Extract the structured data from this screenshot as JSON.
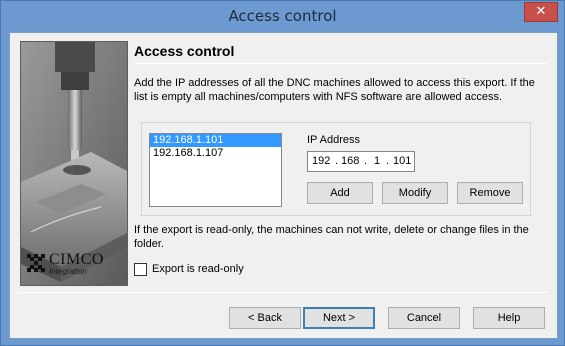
{
  "window": {
    "title": "Access control",
    "close_label": "✕"
  },
  "wizard": {
    "heading": "Access control",
    "description": "Add the IP addresses of all the DNC machines allowed to access this export. If the list is empty all machines/computers with NFS software are allowed access."
  },
  "ip_list": {
    "items": [
      "192.168.1.101",
      "192.168.1.107"
    ],
    "selected_index": 0
  },
  "ip_address": {
    "label": "IP Address",
    "octets": [
      "192",
      "168",
      "1",
      "101"
    ],
    "separator": "."
  },
  "buttons": {
    "add": "Add",
    "modify": "Modify",
    "remove": "Remove"
  },
  "readonly": {
    "note": "If the export is read-only, the machines can not write, delete or change files in the folder.",
    "checkbox_label": "Export is read-only",
    "checked": false
  },
  "nav": {
    "back": "< Back",
    "next": "Next >",
    "cancel": "Cancel",
    "help": "Help"
  },
  "logo": {
    "name": "CIMCO",
    "subtitle": "Integration"
  },
  "colors": {
    "titlebar": "#6c9ad0",
    "close_button": "#c7504a",
    "selection": "#3399ff"
  }
}
